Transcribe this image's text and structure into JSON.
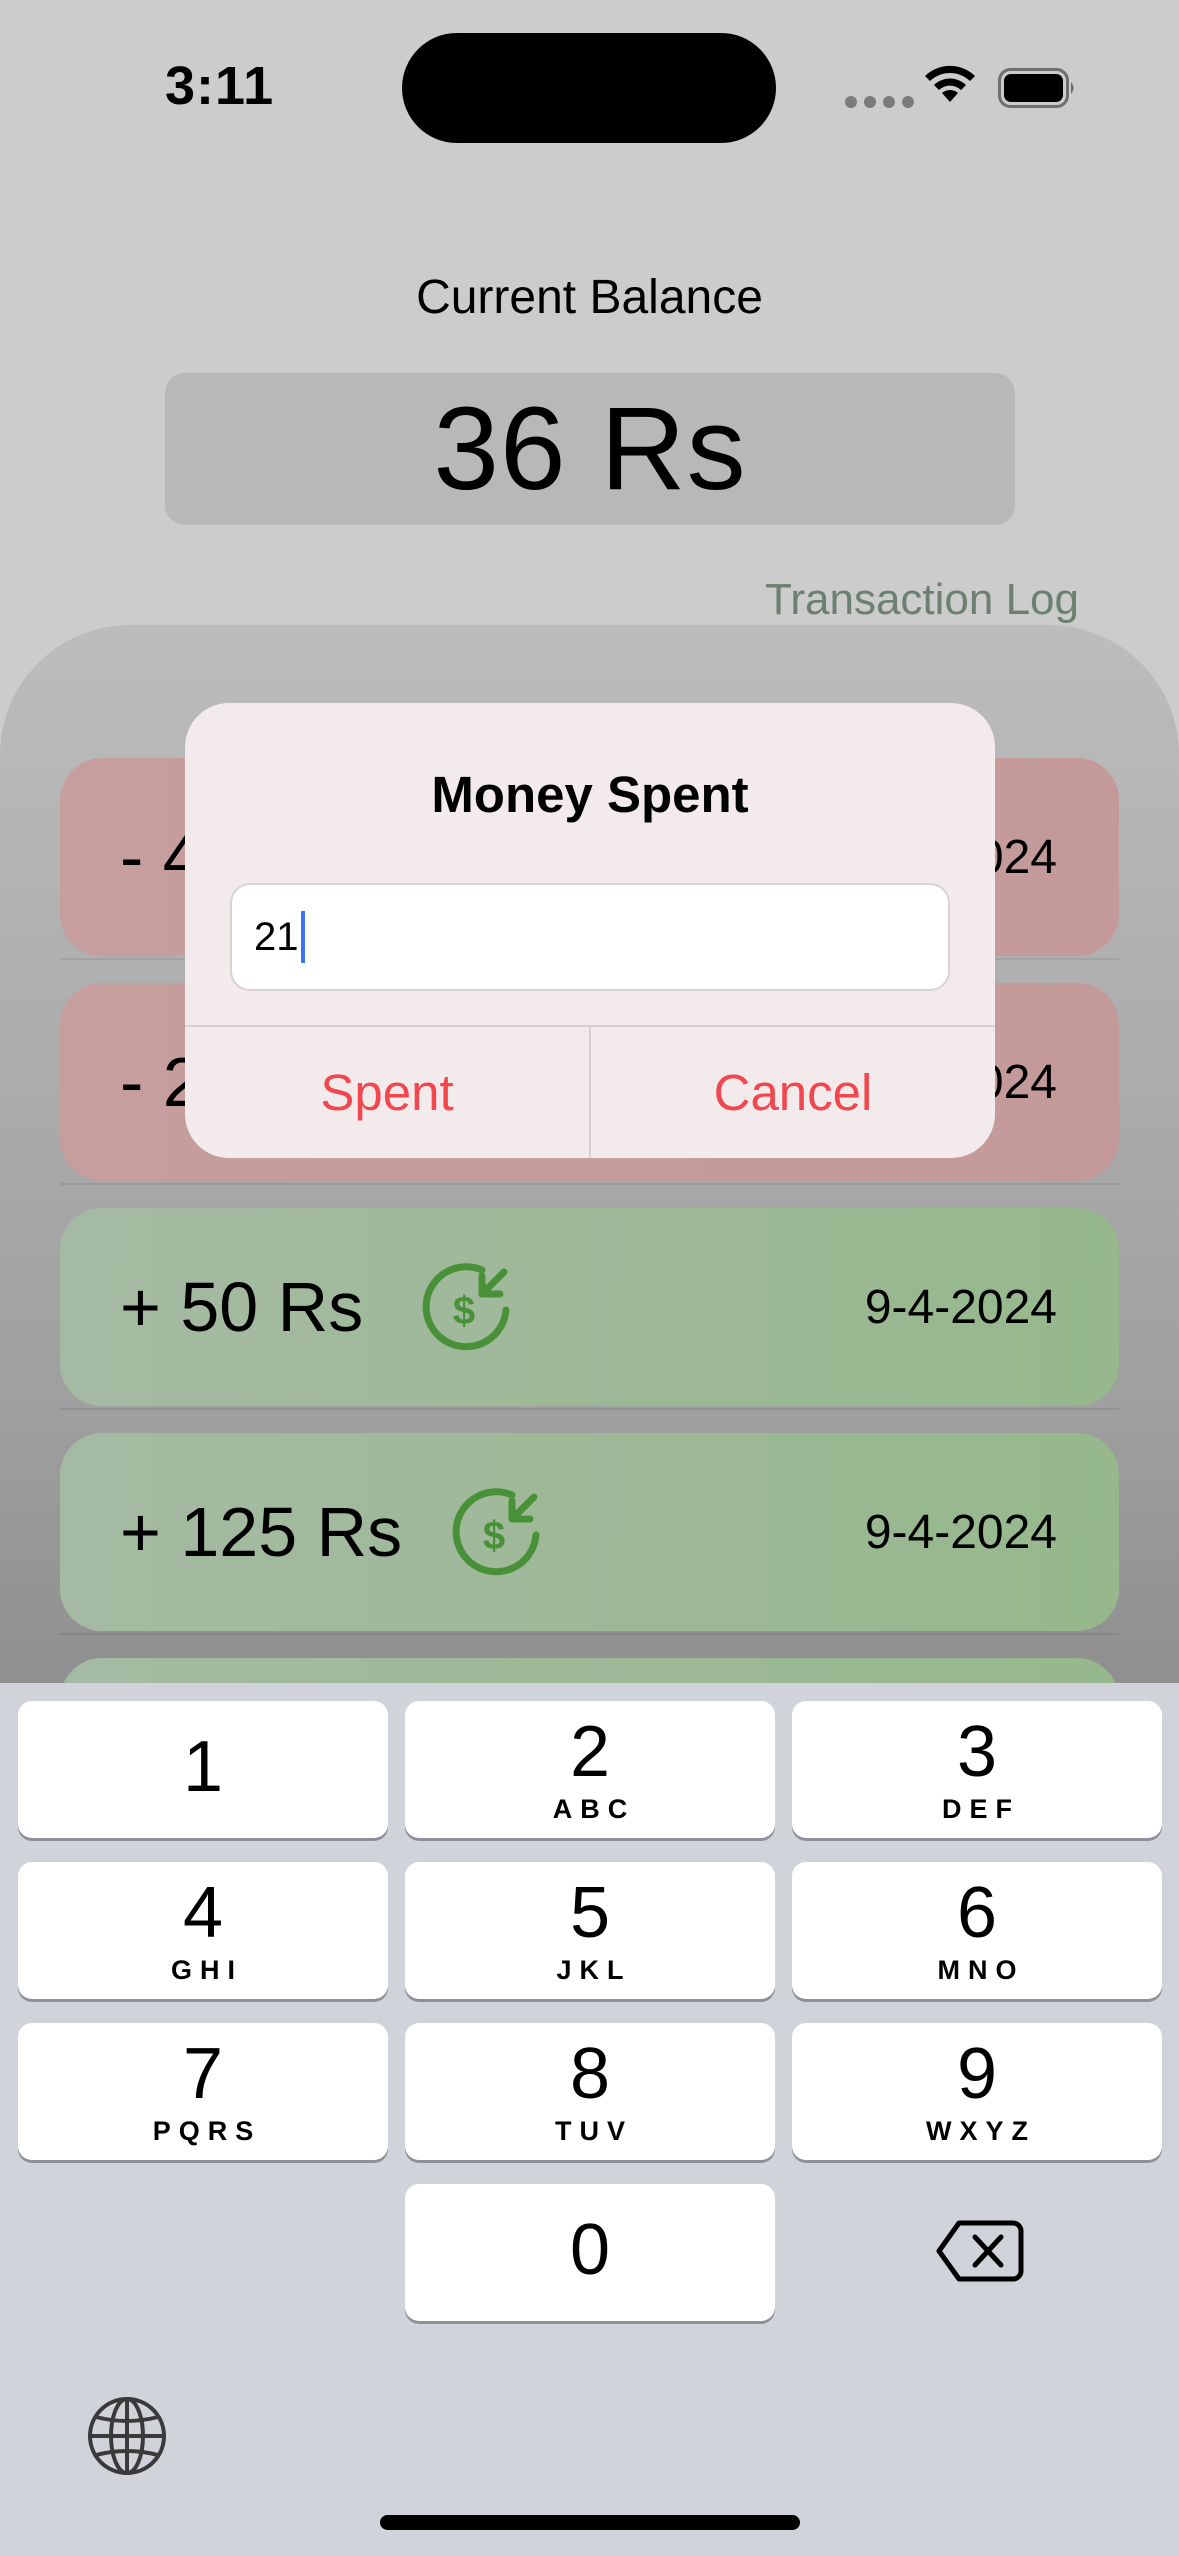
{
  "status_bar": {
    "time": "3:11"
  },
  "header": {
    "balance_label": "Current Balance",
    "balance_value": "36 Rs",
    "transaction_log_link": "Transaction Log"
  },
  "transactions": [
    {
      "type": "spent",
      "amount": "- 4",
      "date": "024"
    },
    {
      "type": "spent",
      "amount": "- 2",
      "date": "024"
    },
    {
      "type": "earned",
      "amount": "+ 50 Rs",
      "date": "9-4-2024",
      "icon": "dollar-income-icon"
    },
    {
      "type": "earned",
      "amount": "+ 125 Rs",
      "date": "9-4-2024",
      "icon": "dollar-income-icon"
    }
  ],
  "alert": {
    "title": "Money Spent",
    "input_value": "21",
    "confirm_label": "Spent",
    "cancel_label": "Cancel"
  },
  "keypad": {
    "keys": [
      {
        "num": "1",
        "letters": ""
      },
      {
        "num": "2",
        "letters": "ABC"
      },
      {
        "num": "3",
        "letters": "DEF"
      },
      {
        "num": "4",
        "letters": "GHI"
      },
      {
        "num": "5",
        "letters": "JKL"
      },
      {
        "num": "6",
        "letters": "MNO"
      },
      {
        "num": "7",
        "letters": "PQRS"
      },
      {
        "num": "8",
        "letters": "TUV"
      },
      {
        "num": "9",
        "letters": "WXYZ"
      },
      {
        "num": "0",
        "letters": ""
      }
    ]
  },
  "colors": {
    "accent_red": "#f2474f",
    "spent_card": "#f8c6c6",
    "earned_card": "#bce6b0",
    "income_icon_green": "#5cb648",
    "link_color": "#86a08c"
  }
}
